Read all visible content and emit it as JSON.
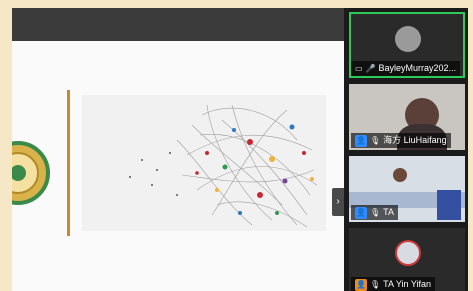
{
  "app": {
    "accent": "#2fc85a",
    "host_color": "#2d8cff"
  },
  "participants": [
    {
      "name": "BayleyMurray202...",
      "icons": [
        "screen-share-icon",
        "microphone-icon"
      ],
      "active": true
    },
    {
      "name": "海方 LiuHaifang",
      "icons": [
        "host-badge-icon",
        "microphone-muted-icon"
      ],
      "active": false
    },
    {
      "name": "TA",
      "icons": [
        "host-badge-icon",
        "microphone-muted-icon"
      ],
      "active": false
    },
    {
      "name": "TA Yin Yifan",
      "icons": [
        "host-badge-icon",
        "microphone-muted-icon"
      ],
      "active": false
    }
  ],
  "controls": {
    "collapse_glyph": "›"
  }
}
